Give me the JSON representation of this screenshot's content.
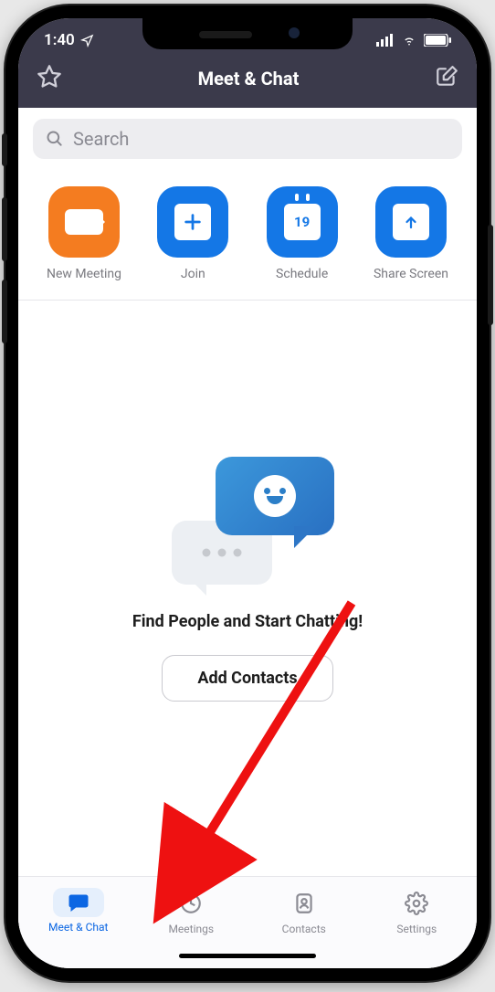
{
  "status": {
    "time": "1:40"
  },
  "nav": {
    "title": "Meet & Chat"
  },
  "search": {
    "placeholder": "Search"
  },
  "actions": {
    "new_meeting": "New Meeting",
    "join": "Join",
    "schedule": "Schedule",
    "schedule_day": "19",
    "share": "Share Screen"
  },
  "empty": {
    "headline": "Find People and Start Chatting!",
    "button": "Add Contacts"
  },
  "tabs": {
    "meetchat": "Meet & Chat",
    "meetings": "Meetings",
    "contacts": "Contacts",
    "settings": "Settings"
  }
}
